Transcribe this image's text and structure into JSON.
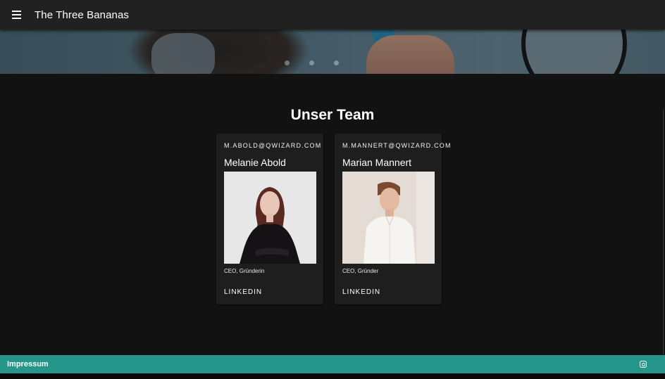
{
  "app": {
    "title": "The Three Bananas"
  },
  "hero": {
    "slide_count": 3
  },
  "team": {
    "heading": "Unser Team",
    "members": [
      {
        "email": "m.abold@qwizard.com",
        "name": "Melanie Abold",
        "role": "CEO, Gründerin",
        "link_label": "LINKEDIN"
      },
      {
        "email": "m.mannert@qwizard.com",
        "name": "Marian Mannert",
        "role": "CEO, Gründer",
        "link_label": "LINKEDIN"
      }
    ]
  },
  "footer": {
    "impressum_label": "Impressum",
    "social_icon": "instagram-icon"
  },
  "colors": {
    "appbar": "#212121",
    "background": "#121212",
    "card": "#1e1e1e",
    "footer": "#26968a"
  }
}
